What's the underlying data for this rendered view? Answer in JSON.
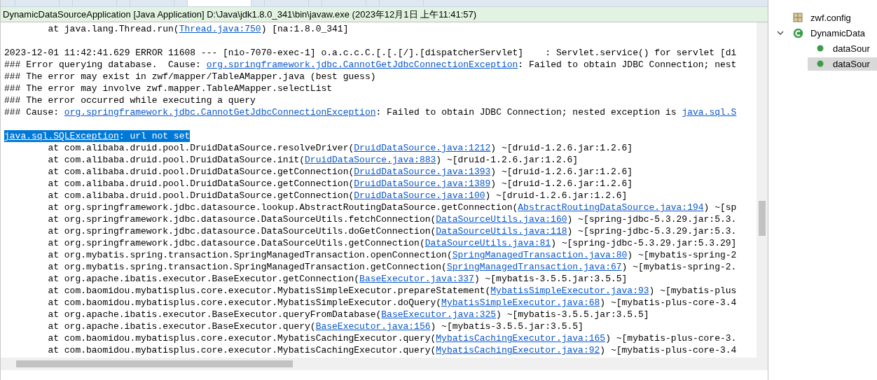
{
  "tabs": [
    {
      "selected": false
    },
    {
      "selected": false
    },
    {
      "selected": false
    },
    {
      "selected": true
    },
    {
      "selected": false
    },
    {
      "selected": false
    },
    {
      "selected": false
    }
  ],
  "console": {
    "title": "DynamicDataSourceApplication [Java Application] D:\\Java\\jdk1.8.0_341\\bin\\javaw.exe (2023年12月1日 上午11:41:57)",
    "lines": [
      {
        "indent": true,
        "selected": false,
        "parts": [
          {
            "kind": "plain",
            "text": "at java.lang.Thread.run("
          },
          {
            "kind": "link",
            "text": "Thread.java:750"
          },
          {
            "kind": "plain",
            "text": ") [na:1.8.0_341]"
          }
        ]
      },
      {
        "kind": "blank"
      },
      {
        "indent": false,
        "selected": false,
        "parts": [
          {
            "kind": "plain",
            "text": "2023-12-01 11:42:41.629 ERROR 11608 --- [nio-7070-exec-1] o.a.c.c.C.[.[.[/].[dispatcherServlet]    : Servlet.service() for servlet [di"
          }
        ]
      },
      {
        "indent": false,
        "selected": false,
        "parts": [
          {
            "kind": "plain",
            "text": "### Error querying database.  Cause: "
          },
          {
            "kind": "link",
            "text": "org.springframework.jdbc.CannotGetJdbcConnectionException"
          },
          {
            "kind": "plain",
            "text": ": Failed to obtain JDBC Connection; nest"
          }
        ]
      },
      {
        "indent": false,
        "selected": false,
        "parts": [
          {
            "kind": "plain",
            "text": "### The error may exist in zwf/mapper/TableAMapper.java (best guess)"
          }
        ]
      },
      {
        "indent": false,
        "selected": false,
        "parts": [
          {
            "kind": "plain",
            "text": "### The error may involve zwf.mapper.TableAMapper.selectList"
          }
        ]
      },
      {
        "indent": false,
        "selected": false,
        "parts": [
          {
            "kind": "plain",
            "text": "### The error occurred while executing a query"
          }
        ]
      },
      {
        "indent": false,
        "selected": false,
        "parts": [
          {
            "kind": "plain",
            "text": "### Cause: "
          },
          {
            "kind": "link",
            "text": "org.springframework.jdbc.CannotGetJdbcConnectionException"
          },
          {
            "kind": "plain",
            "text": ": Failed to obtain JDBC Connection; nested exception is "
          },
          {
            "kind": "link",
            "text": "java.sql.S"
          }
        ]
      },
      {
        "kind": "blank"
      },
      {
        "indent": false,
        "selected": true,
        "parts": [
          {
            "kind": "link",
            "text": "java.sql.SQLException"
          },
          {
            "kind": "plain",
            "text": ": url not set"
          }
        ]
      },
      {
        "indent": true,
        "selected": false,
        "parts": [
          {
            "kind": "plain",
            "text": "at com.alibaba.druid.pool.DruidDataSource.resolveDriver("
          },
          {
            "kind": "link",
            "text": "DruidDataSource.java:1212"
          },
          {
            "kind": "plain",
            "text": ") ~[druid-1.2.6.jar:1.2.6]"
          }
        ]
      },
      {
        "indent": true,
        "selected": false,
        "parts": [
          {
            "kind": "plain",
            "text": "at com.alibaba.druid.pool.DruidDataSource.init("
          },
          {
            "kind": "link",
            "text": "DruidDataSource.java:883"
          },
          {
            "kind": "plain",
            "text": ") ~[druid-1.2.6.jar:1.2.6]"
          }
        ]
      },
      {
        "indent": true,
        "selected": false,
        "parts": [
          {
            "kind": "plain",
            "text": "at com.alibaba.druid.pool.DruidDataSource.getConnection("
          },
          {
            "kind": "link",
            "text": "DruidDataSource.java:1393"
          },
          {
            "kind": "plain",
            "text": ") ~[druid-1.2.6.jar:1.2.6]"
          }
        ]
      },
      {
        "indent": true,
        "selected": false,
        "parts": [
          {
            "kind": "plain",
            "text": "at com.alibaba.druid.pool.DruidDataSource.getConnection("
          },
          {
            "kind": "link",
            "text": "DruidDataSource.java:1389"
          },
          {
            "kind": "plain",
            "text": ") ~[druid-1.2.6.jar:1.2.6]"
          }
        ]
      },
      {
        "indent": true,
        "selected": false,
        "parts": [
          {
            "kind": "plain",
            "text": "at com.alibaba.druid.pool.DruidDataSource.getConnection("
          },
          {
            "kind": "link",
            "text": "DruidDataSource.java:100"
          },
          {
            "kind": "plain",
            "text": ") ~[druid-1.2.6.jar:1.2.6]"
          }
        ]
      },
      {
        "indent": true,
        "selected": false,
        "parts": [
          {
            "kind": "plain",
            "text": "at org.springframework.jdbc.datasource.lookup.AbstractRoutingDataSource.getConnection("
          },
          {
            "kind": "link",
            "text": "AbstractRoutingDataSource.java:194"
          },
          {
            "kind": "plain",
            "text": ") ~[sp"
          }
        ]
      },
      {
        "indent": true,
        "selected": false,
        "parts": [
          {
            "kind": "plain",
            "text": "at org.springframework.jdbc.datasource.DataSourceUtils.fetchConnection("
          },
          {
            "kind": "link",
            "text": "DataSourceUtils.java:160"
          },
          {
            "kind": "plain",
            "text": ") ~[spring-jdbc-5.3.29.jar:5.3."
          }
        ]
      },
      {
        "indent": true,
        "selected": false,
        "parts": [
          {
            "kind": "plain",
            "text": "at org.springframework.jdbc.datasource.DataSourceUtils.doGetConnection("
          },
          {
            "kind": "link",
            "text": "DataSourceUtils.java:118"
          },
          {
            "kind": "plain",
            "text": ") ~[spring-jdbc-5.3.29.jar:5.3."
          }
        ]
      },
      {
        "indent": true,
        "selected": false,
        "parts": [
          {
            "kind": "plain",
            "text": "at org.springframework.jdbc.datasource.DataSourceUtils.getConnection("
          },
          {
            "kind": "link",
            "text": "DataSourceUtils.java:81"
          },
          {
            "kind": "plain",
            "text": ") ~[spring-jdbc-5.3.29.jar:5.3.29]"
          }
        ]
      },
      {
        "indent": true,
        "selected": false,
        "parts": [
          {
            "kind": "plain",
            "text": "at org.mybatis.spring.transaction.SpringManagedTransaction.openConnection("
          },
          {
            "kind": "link",
            "text": "SpringManagedTransaction.java:80"
          },
          {
            "kind": "plain",
            "text": ") ~[mybatis-spring-2"
          }
        ]
      },
      {
        "indent": true,
        "selected": false,
        "parts": [
          {
            "kind": "plain",
            "text": "at org.mybatis.spring.transaction.SpringManagedTransaction.getConnection("
          },
          {
            "kind": "link",
            "text": "SpringManagedTransaction.java:67"
          },
          {
            "kind": "plain",
            "text": ") ~[mybatis-spring-2."
          }
        ]
      },
      {
        "indent": true,
        "selected": false,
        "parts": [
          {
            "kind": "plain",
            "text": "at org.apache.ibatis.executor.BaseExecutor.getConnection("
          },
          {
            "kind": "link",
            "text": "BaseExecutor.java:337"
          },
          {
            "kind": "plain",
            "text": ") ~[mybatis-3.5.5.jar:3.5.5]"
          }
        ]
      },
      {
        "indent": true,
        "selected": false,
        "parts": [
          {
            "kind": "plain",
            "text": "at com.baomidou.mybatisplus.core.executor.MybatisSimpleExecutor.prepareStatement("
          },
          {
            "kind": "link",
            "text": "MybatisSimpleExecutor.java:93"
          },
          {
            "kind": "plain",
            "text": ") ~[mybatis-plus"
          }
        ]
      },
      {
        "indent": true,
        "selected": false,
        "parts": [
          {
            "kind": "plain",
            "text": "at com.baomidou.mybatisplus.core.executor.MybatisSimpleExecutor.doQuery("
          },
          {
            "kind": "link",
            "text": "MybatisSimpleExecutor.java:68"
          },
          {
            "kind": "plain",
            "text": ") ~[mybatis-plus-core-3.4"
          }
        ]
      },
      {
        "indent": true,
        "selected": false,
        "parts": [
          {
            "kind": "plain",
            "text": "at org.apache.ibatis.executor.BaseExecutor.queryFromDatabase("
          },
          {
            "kind": "link",
            "text": "BaseExecutor.java:325"
          },
          {
            "kind": "plain",
            "text": ") ~[mybatis-3.5.5.jar:3.5.5]"
          }
        ]
      },
      {
        "indent": true,
        "selected": false,
        "parts": [
          {
            "kind": "plain",
            "text": "at org.apache.ibatis.executor.BaseExecutor.query("
          },
          {
            "kind": "link",
            "text": "BaseExecutor.java:156"
          },
          {
            "kind": "plain",
            "text": ") ~[mybatis-3.5.5.jar:3.5.5]"
          }
        ]
      },
      {
        "indent": true,
        "selected": false,
        "parts": [
          {
            "kind": "plain",
            "text": "at com.baomidou.mybatisplus.core.executor.MybatisCachingExecutor.query("
          },
          {
            "kind": "link",
            "text": "MybatisCachingExecutor.java:165"
          },
          {
            "kind": "plain",
            "text": ") ~[mybatis-plus-core-3."
          }
        ]
      },
      {
        "indent": true,
        "selected": false,
        "parts": [
          {
            "kind": "plain",
            "text": "at com.baomidou.mybatisplus.core.executor.MybatisCachingExecutor.query("
          },
          {
            "kind": "link",
            "text": "MybatisCachingExecutor.java:92"
          },
          {
            "kind": "plain",
            "text": ") ~[mybatis-plus-core-3.4"
          }
        ]
      }
    ]
  },
  "outline": {
    "items": [
      {
        "kind": "package",
        "label": "zwf.config",
        "selected": false
      },
      {
        "kind": "class",
        "label": "DynamicData",
        "selected": false,
        "expanded": true,
        "children": [
          {
            "kind": "method",
            "label": "dataSour",
            "selected": false
          },
          {
            "kind": "method",
            "label": "dataSour",
            "selected": true
          }
        ]
      }
    ]
  }
}
